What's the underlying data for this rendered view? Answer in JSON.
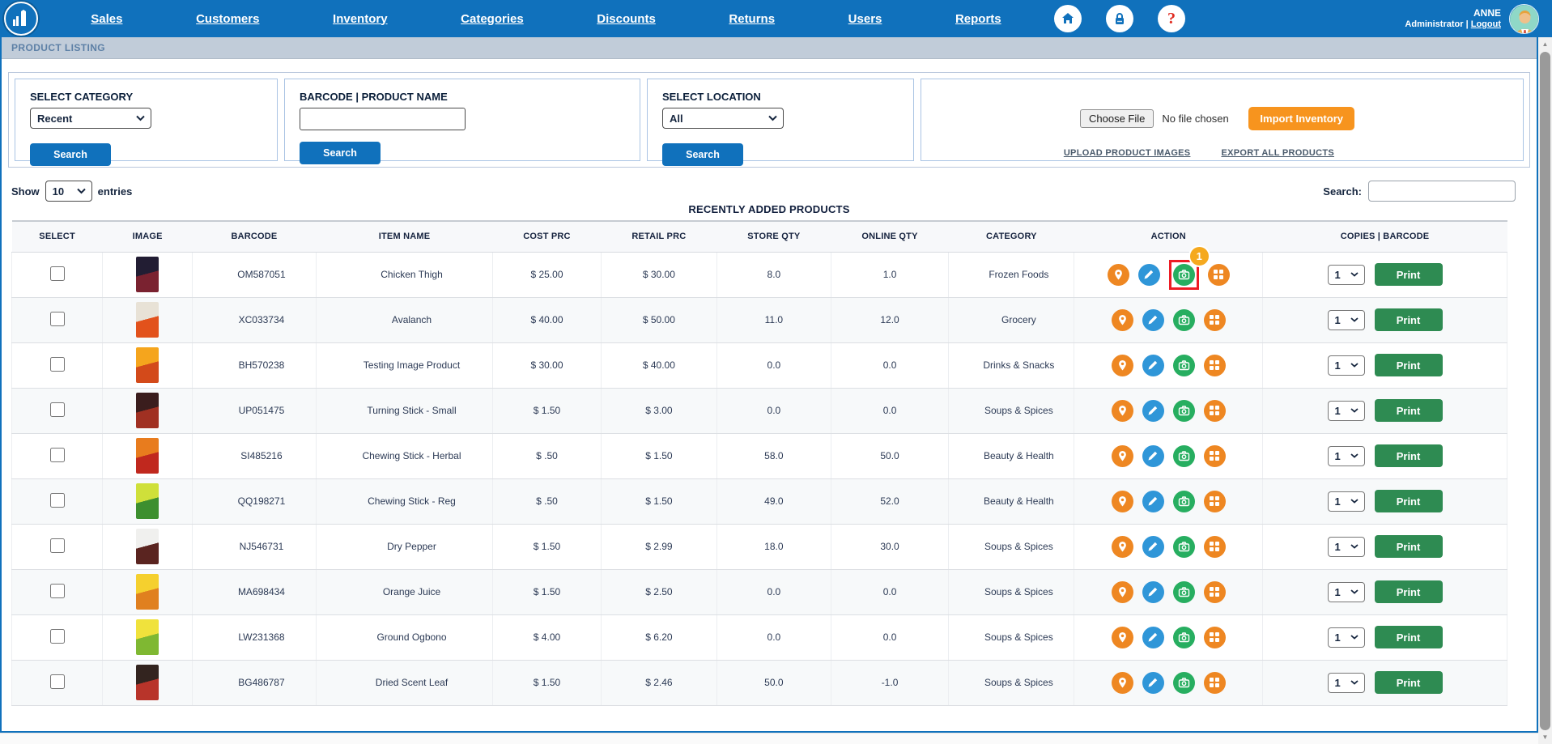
{
  "nav": {
    "items": [
      "Sales",
      "Customers",
      "Inventory",
      "Categories",
      "Discounts",
      "Returns",
      "Users",
      "Reports"
    ],
    "user": {
      "name": "ANNE",
      "role": "Administrator",
      "logout": "Logout"
    }
  },
  "breadcrumb": "PRODUCT LISTING",
  "filters": {
    "category": {
      "label": "SELECT CATEGORY",
      "value": "Recent",
      "button": "Search"
    },
    "product": {
      "label": "BARCODE | PRODUCT NAME",
      "value": "",
      "button": "Search"
    },
    "location": {
      "label": "SELECT LOCATION",
      "value": "All",
      "button": "Search"
    },
    "import": {
      "choose_file": "Choose File",
      "file_status": "No file chosen",
      "button": "Import Inventory",
      "upload_link": "UPLOAD PRODUCT IMAGES",
      "export_link": "EXPORT ALL PRODUCTS"
    }
  },
  "controls": {
    "show": "Show",
    "page_size": "10",
    "entries": "entries",
    "search_label": "Search:",
    "search_value": ""
  },
  "table": {
    "title": "RECENTLY ADDED PRODUCTS",
    "headers": [
      "SELECT",
      "IMAGE",
      "BARCODE",
      "ITEM NAME",
      "COST PRC",
      "RETAIL PRC",
      "STORE QTY",
      "ONLINE QTY",
      "CATEGORY",
      "ACTION",
      "COPIES  |  BARCODE"
    ],
    "print_label": "Print",
    "rows": [
      {
        "barcode": "OM587051",
        "item_name": "Chicken Thigh",
        "cost_prc": "$ 25.00",
        "retail_prc": "$ 30.00",
        "store_qty": "8.0",
        "online_qty": "1.0",
        "category": "Frozen Foods",
        "copies": "1",
        "camera_badge": "1",
        "thumb": [
          "#221d33",
          "#7a2230"
        ]
      },
      {
        "barcode": "XC033734",
        "item_name": "Avalanch",
        "cost_prc": "$ 40.00",
        "retail_prc": "$ 50.00",
        "store_qty": "11.0",
        "online_qty": "12.0",
        "category": "Grocery",
        "copies": "1",
        "thumb": [
          "#e8e2d6",
          "#e2521c"
        ]
      },
      {
        "barcode": "BH570238",
        "item_name": "Testing Image Product",
        "cost_prc": "$ 30.00",
        "retail_prc": "$ 40.00",
        "store_qty": "0.0",
        "online_qty": "0.0",
        "category": "Drinks & Snacks",
        "copies": "1",
        "thumb": [
          "#f5a51d",
          "#d34a1a"
        ]
      },
      {
        "barcode": "UP051475",
        "item_name": "Turning Stick - Small",
        "cost_prc": "$ 1.50",
        "retail_prc": "$ 3.00",
        "store_qty": "0.0",
        "online_qty": "0.0",
        "category": "Soups & Spices",
        "copies": "1",
        "thumb": [
          "#3a1d1d",
          "#a03022"
        ]
      },
      {
        "barcode": "SI485216",
        "item_name": "Chewing Stick - Herbal",
        "cost_prc": "$ .50",
        "retail_prc": "$ 1.50",
        "store_qty": "58.0",
        "online_qty": "50.0",
        "category": "Beauty & Health",
        "copies": "1",
        "thumb": [
          "#e87c1e",
          "#c0281e"
        ]
      },
      {
        "barcode": "QQ198271",
        "item_name": "Chewing Stick - Reg",
        "cost_prc": "$ .50",
        "retail_prc": "$ 1.50",
        "store_qty": "49.0",
        "online_qty": "52.0",
        "category": "Beauty & Health",
        "copies": "1",
        "thumb": [
          "#cfe03a",
          "#3d8f2f"
        ]
      },
      {
        "barcode": "NJ546731",
        "item_name": "Dry Pepper",
        "cost_prc": "$ 1.50",
        "retail_prc": "$ 2.99",
        "store_qty": "18.0",
        "online_qty": "30.0",
        "category": "Soups & Spices",
        "copies": "1",
        "thumb": [
          "#f0f0ee",
          "#5a2420"
        ]
      },
      {
        "barcode": "MA698434",
        "item_name": "Orange Juice",
        "cost_prc": "$ 1.50",
        "retail_prc": "$ 2.50",
        "store_qty": "0.0",
        "online_qty": "0.0",
        "category": "Soups & Spices",
        "copies": "1",
        "thumb": [
          "#f5d02e",
          "#e0801f"
        ]
      },
      {
        "barcode": "LW231368",
        "item_name": "Ground Ogbono",
        "cost_prc": "$ 4.00",
        "retail_prc": "$ 6.20",
        "store_qty": "0.0",
        "online_qty": "0.0",
        "category": "Soups & Spices",
        "copies": "1",
        "thumb": [
          "#f0e23c",
          "#7fb832"
        ]
      },
      {
        "barcode": "BG486787",
        "item_name": "Dried Scent Leaf",
        "cost_prc": "$ 1.50",
        "retail_prc": "$ 2.46",
        "store_qty": "50.0",
        "online_qty": "-1.0",
        "category": "Soups & Spices",
        "copies": "1",
        "thumb": [
          "#33241f",
          "#b8342a"
        ]
      }
    ]
  },
  "colors": {
    "nav_blue": "#1071BC",
    "accent_orange": "#F7941E",
    "action_pin_orange": "#EE8722",
    "action_edit_blue": "#2F96D8",
    "action_camera_green": "#27AE60",
    "print_green": "#2E8B52",
    "badge_orange": "#F5A91F",
    "highlight_red": "#ED1C24"
  }
}
